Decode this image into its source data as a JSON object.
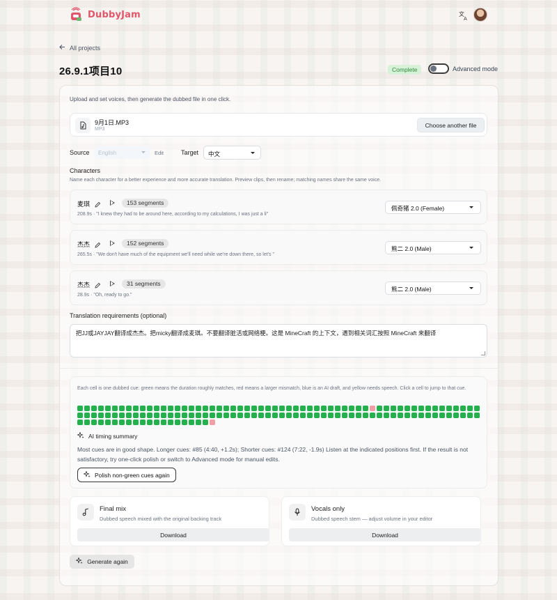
{
  "app": {
    "name": "DubbyJam",
    "brand_color": "#e0566a"
  },
  "header": {
    "translate_icon": "translate-icon",
    "avatar": "avatar"
  },
  "nav": {
    "back_label": "All projects"
  },
  "project": {
    "title": "26.9.1项目10",
    "status": "Complete",
    "status_color": "#2f8a3c",
    "advanced_mode_label": "Advanced mode",
    "advanced_mode_on": false
  },
  "intro": "Upload and set voices, then generate the dubbed file in one click.",
  "file": {
    "name": "9月1日.MP3",
    "type": "MP3",
    "choose_label": "Choose another file"
  },
  "languages": {
    "source_label": "Source",
    "source_value": "English",
    "edit_label": "Edit",
    "target_label": "Target",
    "target_value": "中文"
  },
  "characters": {
    "title": "Characters",
    "hint": "Name each character for a better experience and more accurate translation. Preview clips, then rename; matching names share the same voice.",
    "items": [
      {
        "name": "麦琪",
        "segments": "153 segments",
        "meta": "208.9s · \"I knew they had to be around here, according to my calculations, I was just a li\"",
        "voice": "佩奇猪 2.0 (Female)"
      },
      {
        "name": "杰杰",
        "segments": "152 segments",
        "meta": "265.5s · \"We don't have much of the equipment we'll need while we're down there, so let's \"",
        "voice": "熊二 2.0 (Male)"
      },
      {
        "name": "杰杰",
        "segments": "31 segments",
        "meta": "28.9s · \"Oh, ready to go.\"",
        "voice": "熊二 2.0 (Male)"
      }
    ]
  },
  "translation": {
    "label": "Translation requirements (optional)",
    "value": "把JJ或JAYJAY翻译成杰杰。把micky翻译成麦琪。不要翻译脏活或网络梗。这是 MineCraft 的上下文，遇到相关词汇按照 MineCraft 来翻译"
  },
  "timing": {
    "description": "Each cell is one dubbed cue: green means the duration roughly matches, red means a larger mismatch, blue is an AI draft, and yellow needs speech. Click a cell to jump to that cue.",
    "green_color": "#22b14c",
    "red_color": "#f19fa4",
    "cells": {
      "total": 136,
      "red_indices": [
        43,
        136
      ]
    },
    "ai_title": "AI timing summary",
    "ai_body": "Most cues are in good shape. Longer cues: #85 (4:40, +1.2s); Shorter cues: #124 (7:22, -1.9s) Listen at the indicated positions first. If the result is not satisfactory, try one-click polish or switch to Advanced mode for manual edits.",
    "polish_label": "Polish non-green cues again"
  },
  "outputs": [
    {
      "title": "Final mix",
      "subtitle": "Dubbed speech mixed with the original backing track",
      "download_label": "Download",
      "icon": "music-note-icon"
    },
    {
      "title": "Vocals only",
      "subtitle": "Dubbed speech stem — adjust volume in your editor",
      "download_label": "Download",
      "icon": "microphone-icon"
    }
  ],
  "generate_label": "Generate again"
}
